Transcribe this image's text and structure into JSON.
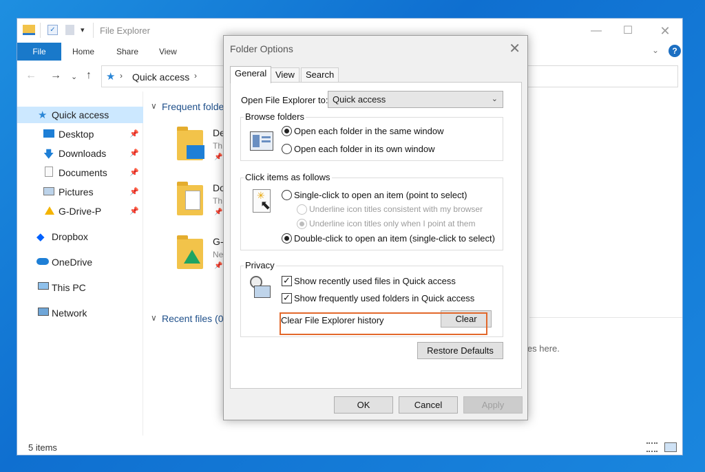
{
  "explorer": {
    "title": "File Explorer",
    "ribbon": {
      "file": "File",
      "home": "Home",
      "share": "Share",
      "view": "View"
    },
    "address": {
      "current": "Quick access"
    },
    "nav": {
      "quick_access": "Quick access",
      "desktop": "Desktop",
      "downloads": "Downloads",
      "documents": "Documents",
      "pictures": "Pictures",
      "gdrive": "G-Drive-P",
      "dropbox": "Dropbox",
      "onedrive": "OneDrive",
      "thispc": "This PC",
      "network": "Network"
    },
    "content": {
      "frequent_header": "Frequent folde",
      "recent_header": "Recent files (0)",
      "items": [
        {
          "name": "De",
          "sub": "Th"
        },
        {
          "name": "Do",
          "sub": "Th"
        },
        {
          "name": "G-",
          "sub": "Ne"
        }
      ],
      "empty_hint": "ies here."
    },
    "status": "5 items"
  },
  "dialog": {
    "title": "Folder Options",
    "tabs": [
      "General",
      "View",
      "Search"
    ],
    "open_to_label": "Open File Explorer to:",
    "open_to_value": "Quick access",
    "browse": {
      "title": "Browse folders",
      "same_window": "Open each folder in the same window",
      "own_window": "Open each folder in its own window"
    },
    "click": {
      "title": "Click items as follows",
      "single": "Single-click to open an item (point to select)",
      "underline_browser": "Underline icon titles consistent with my browser",
      "underline_point": "Underline icon titles only when I point at them",
      "double": "Double-click to open an item (single-click to select)"
    },
    "privacy": {
      "title": "Privacy",
      "recent_files": "Show recently used files in Quick access",
      "frequent_folders": "Show frequently used folders in Quick access",
      "clear_label": "Clear File Explorer history",
      "clear_btn": "Clear"
    },
    "restore": "Restore Defaults",
    "ok": "OK",
    "cancel": "Cancel",
    "apply": "Apply"
  },
  "colors": {
    "highlight": "#e2672a",
    "file_tab": "#1979ca",
    "selection": "#cce8ff"
  }
}
